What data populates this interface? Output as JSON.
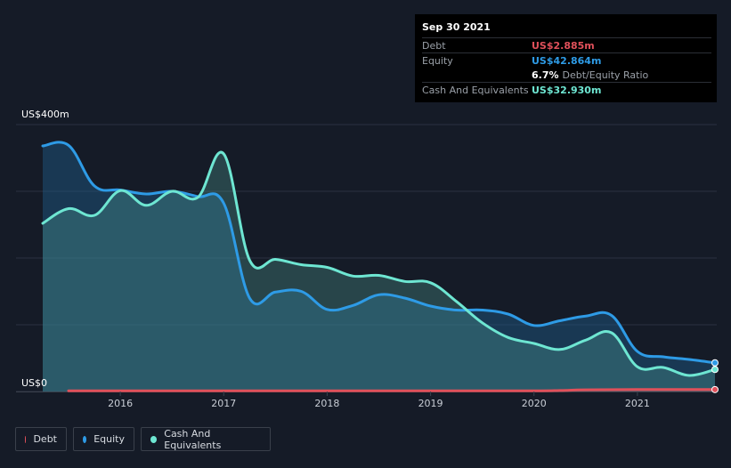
{
  "tooltip": {
    "date": "Sep 30 2021",
    "debt_label": "Debt",
    "debt_value": "US$2.885m",
    "equity_label": "Equity",
    "equity_value": "US$42.864m",
    "ratio_value": "6.7%",
    "ratio_label": "Debt/Equity Ratio",
    "cash_label": "Cash And Equivalents",
    "cash_value": "US$32.930m"
  },
  "legend": [
    {
      "label": "Debt",
      "color": "#e0505a"
    },
    {
      "label": "Equity",
      "color": "#2e9be6"
    },
    {
      "label": "Cash And Equivalents",
      "color": "#6ee6d2"
    }
  ],
  "colors": {
    "debt": "#e0505a",
    "equity": "#2e9be6",
    "cash": "#6ee6d2",
    "background": "#151b27"
  },
  "chart_data": {
    "type": "area",
    "title": "",
    "xlabel": "",
    "ylabel": "",
    "y_unit": "US$m",
    "ylim": [
      0,
      400
    ],
    "xlim": [
      2015.25,
      2021.75
    ],
    "y_ticks": [
      {
        "value": 400,
        "label": "US$400m"
      },
      {
        "value": 0,
        "label": "US$0"
      }
    ],
    "x_ticks": [
      {
        "value": 2016,
        "label": "2016"
      },
      {
        "value": 2017,
        "label": "2017"
      },
      {
        "value": 2018,
        "label": "2018"
      },
      {
        "value": 2019,
        "label": "2019"
      },
      {
        "value": 2020,
        "label": "2020"
      },
      {
        "value": 2021,
        "label": "2021"
      }
    ],
    "grid": true,
    "legend_position": "bottom-left",
    "series": [
      {
        "name": "Equity",
        "x": [
          2015.25,
          2015.5,
          2015.75,
          2016.0,
          2016.25,
          2016.5,
          2016.75,
          2017.0,
          2017.25,
          2017.5,
          2017.75,
          2018.0,
          2018.25,
          2018.5,
          2018.75,
          2019.0,
          2019.25,
          2019.5,
          2019.75,
          2020.0,
          2020.25,
          2020.5,
          2020.75,
          2021.0,
          2021.25,
          2021.5,
          2021.75
        ],
        "values": [
          368,
          369,
          308,
          302,
          296,
          300,
          292,
          282,
          140,
          149,
          150,
          123,
          129,
          145,
          140,
          128,
          122,
          122,
          116,
          99,
          106,
          113,
          114,
          60,
          52,
          48,
          43
        ]
      },
      {
        "name": "Cash And Equivalents",
        "x": [
          2015.25,
          2015.5,
          2015.75,
          2016.0,
          2016.25,
          2016.5,
          2016.75,
          2017.0,
          2017.25,
          2017.5,
          2017.75,
          2018.0,
          2018.25,
          2018.5,
          2018.75,
          2019.0,
          2019.25,
          2019.5,
          2019.75,
          2020.0,
          2020.25,
          2020.5,
          2020.75,
          2021.0,
          2021.25,
          2021.5,
          2021.75
        ],
        "values": [
          252,
          274,
          264,
          301,
          279,
          300,
          291,
          356,
          197,
          198,
          190,
          186,
          173,
          174,
          165,
          163,
          135,
          103,
          81,
          72,
          63,
          77,
          88,
          37,
          36,
          24,
          33
        ]
      },
      {
        "name": "Debt",
        "x": [
          2015.5,
          2016.0,
          2017.0,
          2018.0,
          2019.0,
          2020.0,
          2020.25,
          2020.5,
          2021.0,
          2021.75
        ],
        "values": [
          1,
          1,
          1,
          1,
          1,
          1,
          1.5,
          2.5,
          2.9,
          2.885
        ]
      }
    ]
  }
}
